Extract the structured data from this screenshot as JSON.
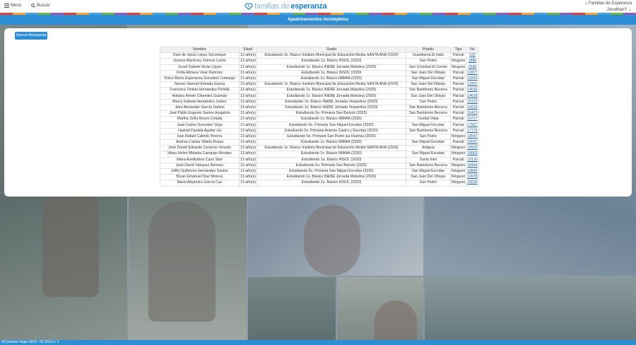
{
  "header": {
    "menu_label": "Menú",
    "search_label": "Buscar",
    "logo_part1": "familias de ",
    "logo_part2": "esperanza",
    "org_name": "Familias de Esperanza",
    "user_name": "JonathanY"
  },
  "page_title": "Apadrinamientos Incompletos",
  "new_search_label": "Nueva Búsqueda",
  "table": {
    "columns": [
      "Nombre",
      "Edad",
      "Grado",
      "Pueblo",
      "Tipo",
      "No"
    ],
    "rows": [
      [
        "Dani de Jesús López Socoreque",
        "13 año(s)",
        "Estudiando 1o. Básico Instituto Municipal de Educación Media SANTA ANA (2020)",
        "Guardianía El Hato",
        "Parcial",
        "633"
      ],
      [
        "Jessica Marlenny Zamora Luche",
        "13 año(s)",
        "Estudiando 1o. Básico INSOL (2020)",
        "San Pedro",
        "Ninguno",
        "1886"
      ],
      [
        "Josué Gabriel Sicán López",
        "13 año(s)",
        "Estudiando 1o. Básico INEBE Jornada Matutina (2020)",
        "San Cristobal El Cerrito",
        "Ninguno",
        "2945"
      ],
      [
        "Frida Adriana Vivar Ramírez",
        "13 año(s)",
        "Estudiando 1o. Básico INSOL (2020)",
        "San Juan Del Obispo",
        "Parcial",
        "12877"
      ],
      [
        "Dulce María Esperanza González Camargo",
        "13 año(s)",
        "Estudiando 1o. Básico IMMAA (2020)",
        "San Miguel Escobar",
        "Parcial",
        "13243"
      ],
      [
        "Steven Samuel Estrada García",
        "13 año(s)",
        "Estudiando 1o. Básico Instituto Municipal de Educación Media SANTA ANA (2020)",
        "San Juan Del Obispo",
        "Parcial",
        "13307"
      ],
      [
        "Francisca Violeta Hernández Pichillá",
        "13 año(s)",
        "Estudiando 1o. Básico INEBE Jornada Matutina (2020)",
        "San Bartolome Becerra",
        "Parcial",
        "14016"
      ],
      [
        "Adriana Aimeé Cifuentes Guzmán",
        "13 año(s)",
        "Estudiando 1o. Básico INEBE Jornada Matutina (2020)",
        "San Juan Del Obispo",
        "Parcial",
        "14639"
      ],
      [
        "Mercy Fabiola Hernández Juárez",
        "13 año(s)",
        "Estudiando 1o. Básico INEBE Jornada Vespertina (2020)",
        "San Pedro",
        "Parcial",
        "15313"
      ],
      [
        "Jairo Alexander García Santos",
        "13 año(s)",
        "Estudiando 1o. Básico INEBE Jornada Vespertina (2020)",
        "San Bartolome Becerra",
        "Parcial",
        "15615"
      ],
      [
        "José Pablo Eugenio Santos Acajabón",
        "13 año(s)",
        "Estudiando 5o. Primaria San Bartolo (2020)",
        "San Bartolome Becerra",
        "Parcial",
        "16413"
      ],
      [
        "Martha Sofía Reyes Celada",
        "13 año(s)",
        "Estudiando 1o. Básico IMMAA (2020)",
        "Ciudad Vieja",
        "Parcial",
        "16717"
      ],
      [
        "Juan Carlos González Vega",
        "13 año(s)",
        "Estudiando 6o. Primaria San Miguel Escobar (2020)",
        "San Miguel Escobar",
        "Parcial",
        "17057"
      ],
      [
        "Hastrid Daniela Aguilar xiá",
        "13 año(s)",
        "Estudiando 5o. Primaria Antonio Castro y Escobar (2020)",
        "San Bartolome Becerra",
        "Parcial",
        "17775"
      ],
      [
        "Ivan Rafael Calindo Pereira",
        "13 año(s)",
        "Estudiando 6o. Primaria San Pedro las Huertas (2020)",
        "San Pedro",
        "Ninguno",
        "18547"
      ],
      [
        "Andrea Camila Villalta Rosas",
        "13 año(s)",
        "Estudiando 1o. Básico IMMAA (2020)",
        "San Miguel Escobar",
        "Parcial",
        "18697"
      ],
      [
        "José Daniel Eduardo Zacarías Venado",
        "13 año(s)",
        "Estudiando 1o. Básico Instituto Municipal de Educación Media SANTA ANA (2020)",
        "Antigua",
        "Ninguno",
        "18933"
      ],
      [
        "Hilary Helen Midania Camargo Morales",
        "13 año(s)",
        "Estudiando 1o. Básico IMMAA (2020)",
        "San Miguel Escobar",
        "Ninguno",
        "19063"
      ],
      [
        "Iliana Auxiliadora Cano Sián",
        "13 año(s)",
        "Estudiando 1o. Básico INSOL (2020)",
        "Santa Inés",
        "Parcial",
        "19130"
      ],
      [
        "José David Vásquez Romero",
        "13 año(s)",
        "Estudiando 5o. Primaria San Bartolo (2020)",
        "San Bartolome Becerra",
        "Ninguno",
        "19444"
      ],
      [
        "Jeffry Guillermo Hernández Santos",
        "13 año(s)",
        "Estudiando 6o. Primaria San Miguel Escobar (2020)",
        "San Miguel Escobar",
        "Ninguno",
        "19845"
      ],
      [
        "Bryan Emanuel Díaz Monroy",
        "13 año(s)",
        "Estudiando 1o. Básico INEBE Jornada Matutina (2020)",
        "San Juan Del Obispo",
        "Ninguno",
        "19978"
      ],
      [
        "María Alejandra García Cac",
        "13 año(s)",
        "Estudiando 1o. Básico INSOL (2020)",
        "San Pedro",
        "Ninguno",
        "20030"
      ]
    ]
  },
  "footer": "©Common Hope 2019 - 02-2019 v. 1",
  "colors": {
    "primary": "#2c8fd6",
    "link": "#1a5fa8"
  }
}
